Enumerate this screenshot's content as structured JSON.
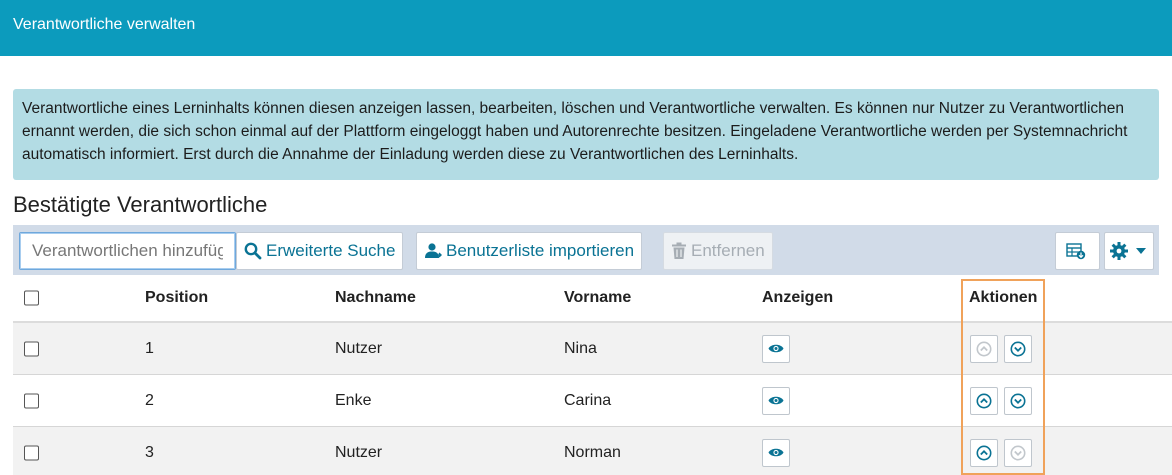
{
  "header": {
    "title": "Verantwortliche verwalten"
  },
  "info": {
    "text": "Verantwortliche eines Lerninhalts können diesen anzeigen lassen, bearbeiten, löschen und Verantwortliche verwalten. Es können nur Nutzer zu Verantwortlichen ernannt werden, die sich schon einmal auf der Plattform eingeloggt haben und Autorenrechte besitzen. Eingeladene Verantwortliche werden per Systemnachricht automatisch informiert. Erst durch die Annahme der Einladung werden diese zu Verantwortlichen des Lerninhalts."
  },
  "section": {
    "title": "Bestätigte Verantwortliche"
  },
  "toolbar": {
    "search_placeholder": "Verantwortlichen hinzufügen",
    "advanced_search_label": "Erweiterte Suche",
    "import_label": "Benutzerliste importieren",
    "remove_label": "Entfernen"
  },
  "table": {
    "headers": {
      "position": "Position",
      "nachname": "Nachname",
      "vorname": "Vorname",
      "anzeigen": "Anzeigen",
      "aktionen": "Aktionen"
    },
    "rows": [
      {
        "position": "1",
        "nachname": "Nutzer",
        "vorname": "Nina",
        "up_enabled": false,
        "down_enabled": true
      },
      {
        "position": "2",
        "nachname": "Enke",
        "vorname": "Carina",
        "up_enabled": true,
        "down_enabled": true
      },
      {
        "position": "3",
        "nachname": "Nutzer",
        "vorname": "Norman",
        "up_enabled": true,
        "down_enabled": false
      }
    ]
  },
  "colors": {
    "header_bg": "#0c9bbd",
    "accent": "#0a7394",
    "highlight": "#f0a25a",
    "info_bg": "#b3dce4"
  }
}
